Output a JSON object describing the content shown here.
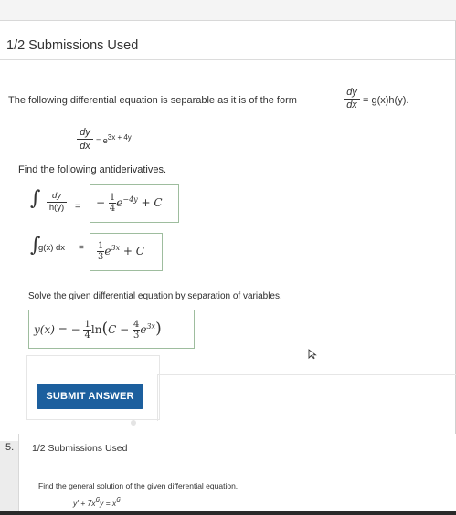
{
  "header": {
    "submissions_used": "1/2 Submissions Used"
  },
  "question": {
    "statement": "The following differential equation is separable as it is of the form",
    "form": {
      "numerator": "dy",
      "denominator": "dx",
      "rhs": "= g(x)h(y)."
    },
    "equation": {
      "numerator": "dy",
      "denominator": "dx",
      "rhs": "= e",
      "exponent": "3x + 4y"
    },
    "find_label": "Find the following antiderivatives.",
    "integral1": {
      "integrand_numerator": "dy",
      "integrand_denominator": "h(y)",
      "equals": "=",
      "answer": {
        "sign": "−",
        "coef_num": "1",
        "coef_den": "4",
        "base": "e",
        "exponent": "−4y",
        "tail": "+ C"
      }
    },
    "integral2": {
      "integrand": "g(x) dx",
      "equals": "=",
      "answer": {
        "coef_num": "1",
        "coef_den": "3",
        "base": "e",
        "exponent": "3x",
        "tail": "+ C"
      }
    },
    "solve_label": "Solve the given differential equation by separation of variables.",
    "solution": {
      "lhs": "y(x) = −",
      "coef_num": "1",
      "coef_den": "4",
      "ln": "ln",
      "paren_open": "(",
      "c_minus": "C −",
      "inner_num": "4",
      "inner_den": "3",
      "base": "e",
      "exponent": "3x",
      "paren_close": ")"
    },
    "submit_label": "SUBMIT ANSWER"
  },
  "next_question": {
    "number": "5.",
    "submissions_used": "1/2 Submissions Used",
    "prompt": "Find the general solution of the given differential equation.",
    "equation": {
      "a": "y' + 7x",
      "a_exp": "6",
      "b": "y = x",
      "b_exp": "6"
    }
  },
  "integral_symbol": "∫",
  "colors": {
    "button": "#1c5f9e",
    "answer_border": "#9ebd9e",
    "background": "#ececec"
  }
}
